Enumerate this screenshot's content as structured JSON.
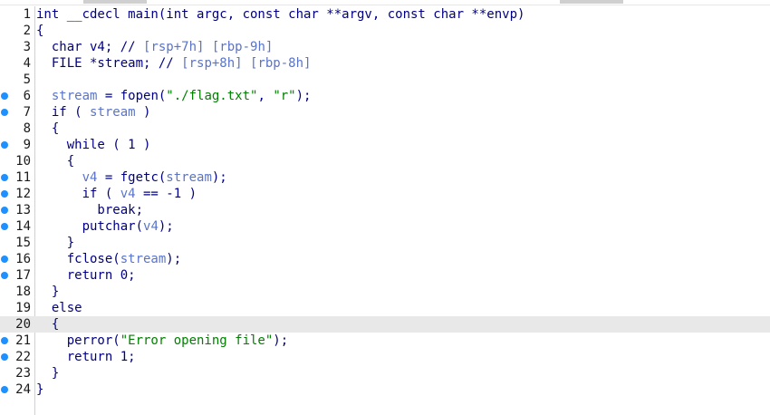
{
  "editor": {
    "lines": [
      {
        "num": "1",
        "bp": false,
        "hl": false,
        "parts": [
          {
            "t": "int __cdecl main(int argc, const char **argv, const char **envp)",
            "c": "n"
          }
        ]
      },
      {
        "num": "2",
        "bp": false,
        "hl": false,
        "parts": [
          {
            "t": "{",
            "c": "n"
          }
        ]
      },
      {
        "num": "3",
        "bp": false,
        "hl": false,
        "parts": [
          {
            "t": "  char v4; // ",
            "c": "n"
          },
          {
            "t": "[rsp+7h] [rbp-9h]",
            "c": "c"
          }
        ]
      },
      {
        "num": "4",
        "bp": false,
        "hl": false,
        "parts": [
          {
            "t": "  FILE *stream; // ",
            "c": "n"
          },
          {
            "t": "[rsp+8h] [rbp-8h]",
            "c": "c"
          }
        ]
      },
      {
        "num": "5",
        "bp": false,
        "hl": false,
        "parts": [
          {
            "t": "",
            "c": "n"
          }
        ]
      },
      {
        "num": "6",
        "bp": true,
        "hl": false,
        "parts": [
          {
            "t": "  ",
            "c": "n"
          },
          {
            "t": "stream",
            "c": "v"
          },
          {
            "t": " = fopen(",
            "c": "n"
          },
          {
            "t": "\"./flag.txt\"",
            "c": "s"
          },
          {
            "t": ", ",
            "c": "n"
          },
          {
            "t": "\"r\"",
            "c": "s"
          },
          {
            "t": ");",
            "c": "n"
          }
        ]
      },
      {
        "num": "7",
        "bp": true,
        "hl": false,
        "parts": [
          {
            "t": "  if ( ",
            "c": "n"
          },
          {
            "t": "stream",
            "c": "v"
          },
          {
            "t": " )",
            "c": "n"
          }
        ]
      },
      {
        "num": "8",
        "bp": false,
        "hl": false,
        "parts": [
          {
            "t": "  {",
            "c": "n"
          }
        ]
      },
      {
        "num": "9",
        "bp": true,
        "hl": false,
        "parts": [
          {
            "t": "    while ( 1 )",
            "c": "n"
          }
        ]
      },
      {
        "num": "10",
        "bp": false,
        "hl": false,
        "parts": [
          {
            "t": "    {",
            "c": "n"
          }
        ]
      },
      {
        "num": "11",
        "bp": true,
        "hl": false,
        "parts": [
          {
            "t": "      ",
            "c": "n"
          },
          {
            "t": "v4",
            "c": "v"
          },
          {
            "t": " = fgetc(",
            "c": "n"
          },
          {
            "t": "stream",
            "c": "v"
          },
          {
            "t": ");",
            "c": "n"
          }
        ]
      },
      {
        "num": "12",
        "bp": true,
        "hl": false,
        "parts": [
          {
            "t": "      if ( ",
            "c": "n"
          },
          {
            "t": "v4",
            "c": "v"
          },
          {
            "t": " == -1 )",
            "c": "n"
          }
        ]
      },
      {
        "num": "13",
        "bp": true,
        "hl": false,
        "parts": [
          {
            "t": "        break;",
            "c": "n"
          }
        ]
      },
      {
        "num": "14",
        "bp": true,
        "hl": false,
        "parts": [
          {
            "t": "      putchar(",
            "c": "n"
          },
          {
            "t": "v4",
            "c": "v"
          },
          {
            "t": ");",
            "c": "n"
          }
        ]
      },
      {
        "num": "15",
        "bp": false,
        "hl": false,
        "parts": [
          {
            "t": "    }",
            "c": "n"
          }
        ]
      },
      {
        "num": "16",
        "bp": true,
        "hl": false,
        "parts": [
          {
            "t": "    fclose(",
            "c": "n"
          },
          {
            "t": "stream",
            "c": "v"
          },
          {
            "t": ");",
            "c": "n"
          }
        ]
      },
      {
        "num": "17",
        "bp": true,
        "hl": false,
        "parts": [
          {
            "t": "    return 0;",
            "c": "n"
          }
        ]
      },
      {
        "num": "18",
        "bp": false,
        "hl": false,
        "parts": [
          {
            "t": "  }",
            "c": "n"
          }
        ]
      },
      {
        "num": "19",
        "bp": false,
        "hl": false,
        "parts": [
          {
            "t": "  else",
            "c": "n"
          }
        ]
      },
      {
        "num": "20",
        "bp": false,
        "hl": true,
        "parts": [
          {
            "t": "  {",
            "c": "n"
          }
        ]
      },
      {
        "num": "21",
        "bp": true,
        "hl": false,
        "parts": [
          {
            "t": "    perror(",
            "c": "n"
          },
          {
            "t": "\"Error opening file\"",
            "c": "s"
          },
          {
            "t": ");",
            "c": "n"
          }
        ]
      },
      {
        "num": "22",
        "bp": true,
        "hl": false,
        "parts": [
          {
            "t": "    return 1;",
            "c": "n"
          }
        ]
      },
      {
        "num": "23",
        "bp": false,
        "hl": false,
        "parts": [
          {
            "t": "  }",
            "c": "n"
          }
        ]
      },
      {
        "num": "24",
        "bp": true,
        "hl": false,
        "parts": [
          {
            "t": "}",
            "c": "n"
          }
        ]
      }
    ]
  },
  "colors": {
    "text": "#000080",
    "variable": "#5a74c8",
    "string": "#008000",
    "breakpoint": "#1e90ff",
    "current_line": "#e8e8e8"
  }
}
